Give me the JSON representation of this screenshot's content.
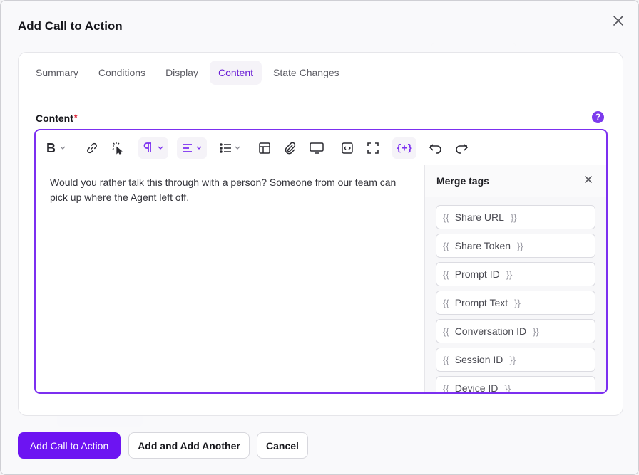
{
  "modal": {
    "title": "Add Call to Action"
  },
  "tabs": [
    "Summary",
    "Conditions",
    "Display",
    "Content",
    "State Changes"
  ],
  "active_tab": "Content",
  "content_field": {
    "label": "Content",
    "required_mark": "*",
    "help_icon": "?"
  },
  "toolbar": {
    "icons": [
      "bold-icon",
      "link-icon",
      "click-icon",
      "paragraph-icon",
      "align-icon",
      "list-icon",
      "table-icon",
      "attachment-icon",
      "preview-icon",
      "source-code-icon",
      "fullscreen-icon",
      "merge-tag-icon",
      "undo-icon",
      "redo-icon"
    ],
    "merge_tag_glyph": "{+}"
  },
  "editor": {
    "text": "Would you rather talk this through with a person? Someone from our team can pick up where the Agent left off."
  },
  "merge_panel": {
    "title": "Merge tags",
    "open_brace": "{{",
    "close_brace": "}}",
    "items": [
      "Share URL",
      "Share Token",
      "Prompt ID",
      "Prompt Text",
      "Conversation ID",
      "Session ID",
      "Device ID"
    ]
  },
  "footer": {
    "primary": "Add Call to Action",
    "add_another": "Add and Add Another",
    "cancel": "Cancel"
  },
  "colors": {
    "accent": "#6d14f2",
    "editor_border": "#7c2ff0"
  }
}
